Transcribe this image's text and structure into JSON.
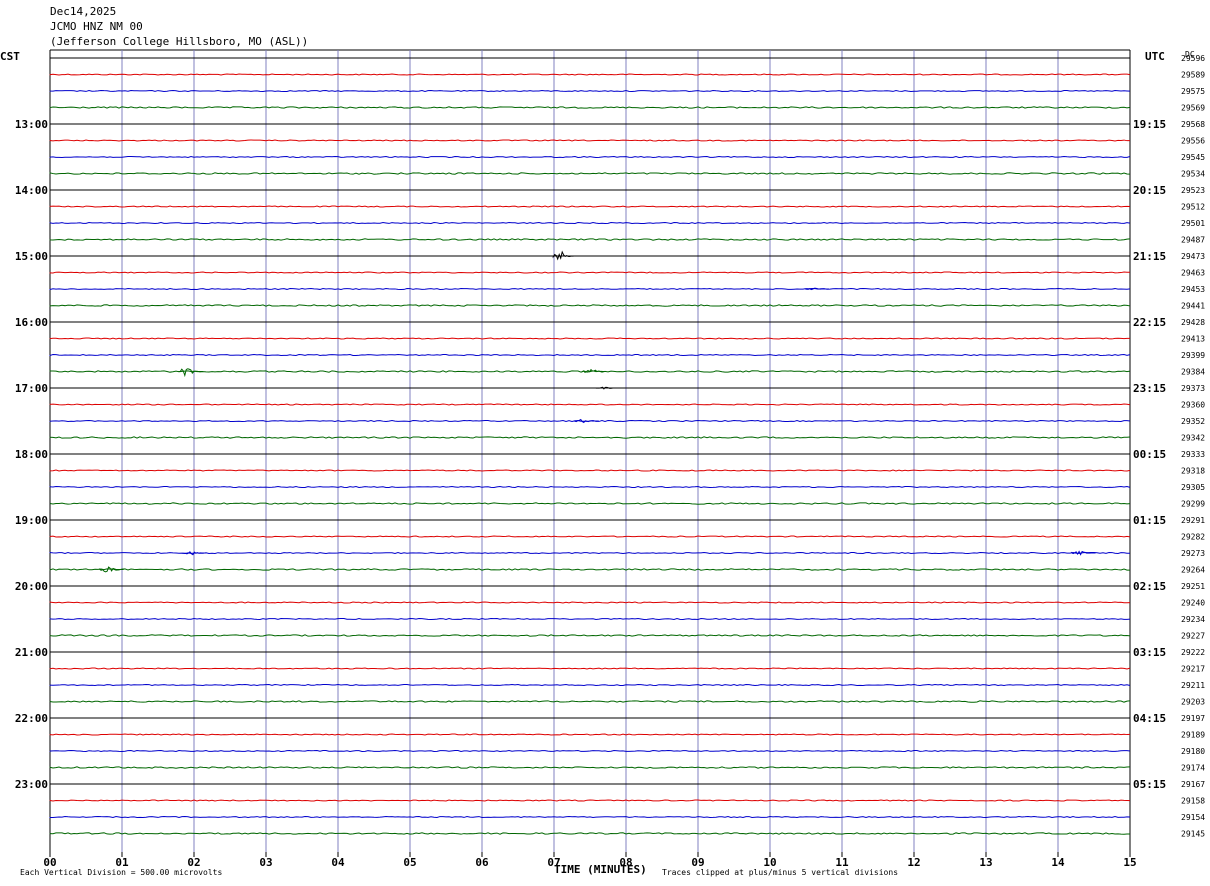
{
  "header": {
    "date": "Dec14,2025",
    "station": "JCMO HNZ NM 00",
    "location": "(Jefferson College Hillsboro, MO (ASL))"
  },
  "left_axis_title": "CST",
  "right_axis_title": "UTC",
  "dc_title": "DC",
  "footer": {
    "scale": "Each Vertical Division =  500.00 microvolts",
    "xlabel": "TIME (MINUTES)",
    "clip_note": "Traces clipped at plus/minus 5 vertical divisions"
  },
  "colors": {
    "red": "#dd0000",
    "blue": "#0000cc",
    "green": "#006600",
    "black": "#000000",
    "gridline": "#8080c0",
    "rowline": "#000000"
  },
  "chart_data": {
    "type": "line",
    "title": "",
    "xlabel": "TIME (MINUTES)",
    "xlim": [
      0,
      15
    ],
    "x_ticks": [
      "00",
      "01",
      "02",
      "03",
      "04",
      "05",
      "06",
      "07",
      "08",
      "09",
      "10",
      "11",
      "12",
      "13",
      "14",
      "15"
    ],
    "rows_per_hour": 4,
    "row_colors": [
      "black",
      "red",
      "blue",
      "green"
    ],
    "left_hour_labels": [
      "13:00",
      "14:00",
      "15:00",
      "16:00",
      "17:00",
      "18:00",
      "19:00",
      "20:00",
      "21:00",
      "22:00",
      "23:00"
    ],
    "right_hour_labels": [
      "19:15",
      "20:15",
      "21:15",
      "22:15",
      "23:15",
      "00:15",
      "01:15",
      "02:15",
      "03:15",
      "04:15",
      "05:15"
    ],
    "dc_values": [
      "29596",
      "29589",
      "29575",
      "29569",
      "29568",
      "29556",
      "29545",
      "29534",
      "29523",
      "29512",
      "29501",
      "29487",
      "29473",
      "29463",
      "29453",
      "29441",
      "29428",
      "29413",
      "29399",
      "29384",
      "29373",
      "29360",
      "29352",
      "29342",
      "29333",
      "29318",
      "29305",
      "29299",
      "29291",
      "29282",
      "29273",
      "29264",
      "29251",
      "29240",
      "29234",
      "29227",
      "29222",
      "29217",
      "29211",
      "29203",
      "29197",
      "29189",
      "29180",
      "29174",
      "29167",
      "29158",
      "29154",
      "29145"
    ],
    "events": [
      {
        "row": 12,
        "minute": 7.1,
        "amplitude": 5
      },
      {
        "row": 19,
        "minute": 1.9,
        "amplitude": 5
      },
      {
        "row": 19,
        "minute": 7.5,
        "amplitude": 3
      },
      {
        "row": 31,
        "minute": 0.8,
        "amplitude": 3
      },
      {
        "row": 30,
        "minute": 1.95,
        "amplitude": 2
      },
      {
        "row": 30,
        "minute": 14.3,
        "amplitude": 2
      },
      {
        "row": 22,
        "minute": 7.4,
        "amplitude": 2
      },
      {
        "row": 20,
        "minute": 7.7,
        "amplitude": 1
      },
      {
        "row": 14,
        "minute": 10.6,
        "amplitude": 1
      }
    ]
  }
}
